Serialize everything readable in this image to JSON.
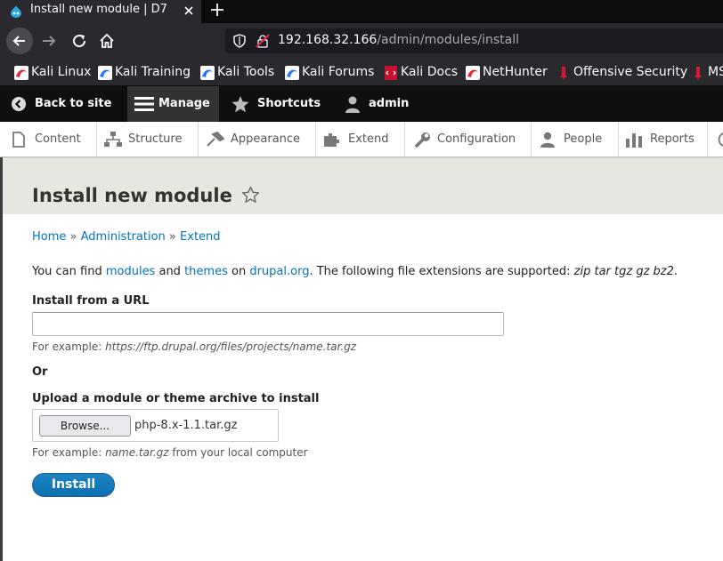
{
  "browser": {
    "tab_title": "Install new module | D7",
    "url_host": "192.168.32.166",
    "url_path": "/admin/modules/install",
    "bookmarks": [
      {
        "label": "Kali Linux"
      },
      {
        "label": "Kali Training"
      },
      {
        "label": "Kali Tools"
      },
      {
        "label": "Kali Forums"
      },
      {
        "label": "Kali Docs"
      },
      {
        "label": "NetHunter"
      },
      {
        "label": "Offensive Security"
      },
      {
        "label": "MS"
      }
    ]
  },
  "toolbar": {
    "back": "Back to site",
    "manage": "Manage",
    "shortcuts": "Shortcuts",
    "user": "admin"
  },
  "tray": {
    "items": [
      {
        "label": "Content"
      },
      {
        "label": "Structure"
      },
      {
        "label": "Appearance"
      },
      {
        "label": "Extend"
      },
      {
        "label": "Configuration"
      },
      {
        "label": "People"
      },
      {
        "label": "Reports"
      }
    ]
  },
  "page": {
    "title": "Install new module",
    "breadcrumb": [
      "Home",
      "Administration",
      "Extend"
    ],
    "breadcrumb_sep": "»",
    "intro": {
      "t1": "You can find ",
      "link1": "modules",
      "t2": " and ",
      "link2": "themes",
      "t3": " on ",
      "link3": "drupal.org",
      "t4": ". The following file extensions are supported: ",
      "extensions": "zip tar tgz gz bz2",
      "t5": "."
    },
    "url_label": "Install from a URL",
    "url_value": "",
    "url_desc_prefix": "For example: ",
    "url_desc_example": "https://ftp.drupal.org/files/projects/name.tar.gz",
    "or": "Or",
    "upload_label": "Upload a module or theme archive to install",
    "browse": "Browse...",
    "file_name": "php-8.x-1.1.tar.gz",
    "upload_desc_prefix": "For example: ",
    "upload_desc_example": "name.tar.gz",
    "upload_desc_suffix": " from your local computer",
    "install": "Install"
  },
  "colors": {
    "link": "#0074bd",
    "toolbar_bg": "#0f0f0f",
    "install_button": "#0c6fb0",
    "header_bg": "#e7e7e2"
  },
  "icons": [
    "drupal-favicon-icon",
    "close-icon",
    "plus-icon",
    "back-arrow-icon",
    "forward-arrow-icon",
    "reload-icon",
    "home-icon",
    "shield-icon",
    "insecure-lock-icon",
    "kali-icon",
    "docs-icon",
    "nethunter-icon",
    "offsec-icon",
    "back-circle-icon",
    "hamburger-icon",
    "star-icon",
    "user-icon",
    "content-icon",
    "structure-icon",
    "appearance-icon",
    "extend-icon",
    "configuration-icon",
    "people-icon",
    "reports-icon",
    "favorite-star-icon"
  ]
}
